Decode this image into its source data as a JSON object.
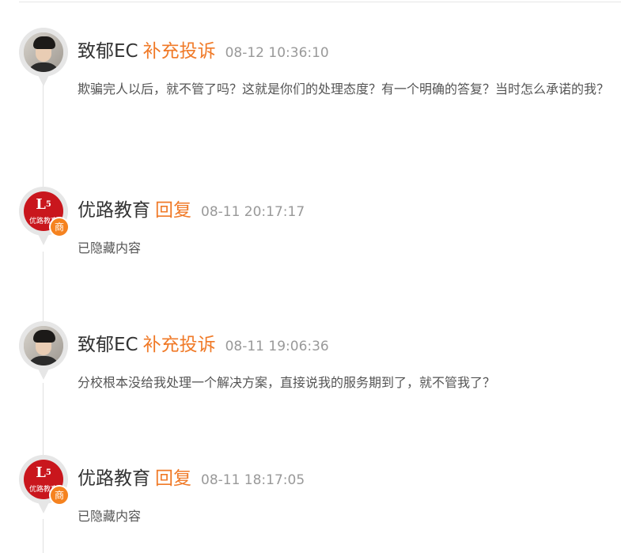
{
  "entries": [
    {
      "author": "致郁EC",
      "action": "补充投诉",
      "time": "08-12 10:36:10",
      "content": "欺骗完人以后，就不管了吗？这就是你们的处理态度？有一个明确的答复？当时怎么承诺的我？",
      "avatar": "user-photo"
    },
    {
      "author": "优路教育",
      "action": "回复",
      "time": "08-11 20:17:17",
      "content": "已隐藏内容",
      "avatar": "merchant-logo",
      "logo_text": "优路教育",
      "logo_mark": "L",
      "badge": "商"
    },
    {
      "author": "致郁EC",
      "action": "补充投诉",
      "time": "08-11 19:06:36",
      "content": "分校根本没给我处理一个解决方案，直接说我的服务期到了，就不管我了？",
      "avatar": "user-photo"
    },
    {
      "author": "优路教育",
      "action": "回复",
      "time": "08-11 18:17:05",
      "content": "已隐藏内容",
      "avatar": "merchant-logo",
      "logo_text": "优路教育",
      "logo_mark": "L",
      "badge": "商"
    }
  ],
  "colors": {
    "action_orange": "#f07a28",
    "badge_orange": "#f5821f",
    "logo_red": "#c9161d",
    "time_gray": "#999999"
  }
}
